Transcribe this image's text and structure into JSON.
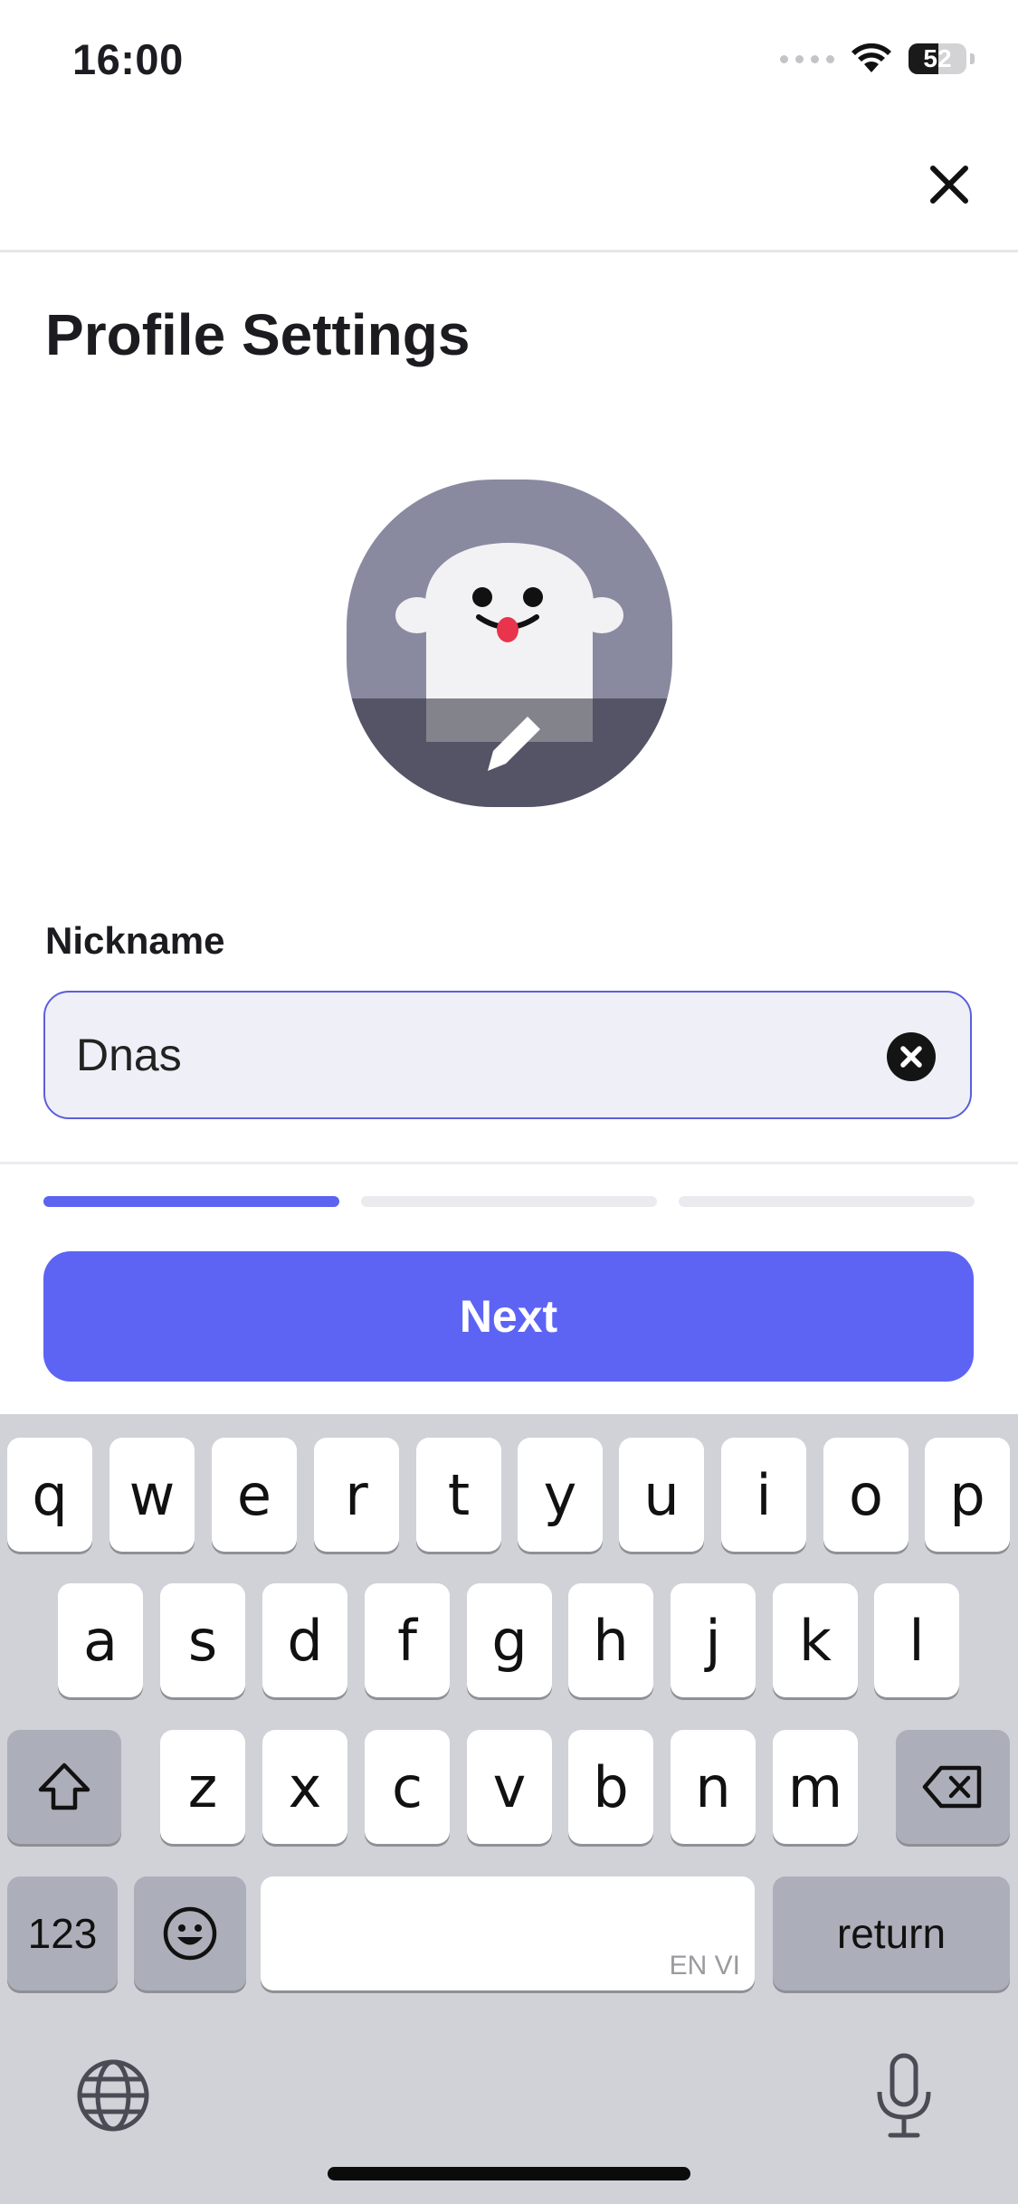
{
  "status_bar": {
    "time": "16:00",
    "battery_level": "52",
    "icons": [
      "signal-icon",
      "wifi-icon",
      "battery-icon"
    ]
  },
  "header": {
    "close_icon": "close-icon"
  },
  "page": {
    "title": "Profile Settings"
  },
  "avatar": {
    "icon": "ghost-avatar",
    "edit_icon": "pencil-icon"
  },
  "form": {
    "nickname_label": "Nickname",
    "nickname_value": "Dnas",
    "clear_icon": "clear-icon"
  },
  "progress": {
    "total_steps": 3,
    "current_step": 1,
    "active_color": "#5b63f0",
    "inactive_color": "#ebebef"
  },
  "actions": {
    "next_label": "Next"
  },
  "colors": {
    "accent": "#5d64f4",
    "keyboard_bg": "#d0d2d8"
  },
  "keyboard": {
    "row1": [
      "q",
      "w",
      "e",
      "r",
      "t",
      "y",
      "u",
      "i",
      "o",
      "p"
    ],
    "row2": [
      "a",
      "s",
      "d",
      "f",
      "g",
      "h",
      "j",
      "k",
      "l"
    ],
    "row3": [
      "z",
      "x",
      "c",
      "v",
      "b",
      "n",
      "m"
    ],
    "numbers_label": "123",
    "return_label": "return",
    "space_language": "EN VI",
    "icons": [
      "shift-icon",
      "backspace-icon",
      "emoji-icon",
      "globe-icon",
      "microphone-icon"
    ]
  }
}
